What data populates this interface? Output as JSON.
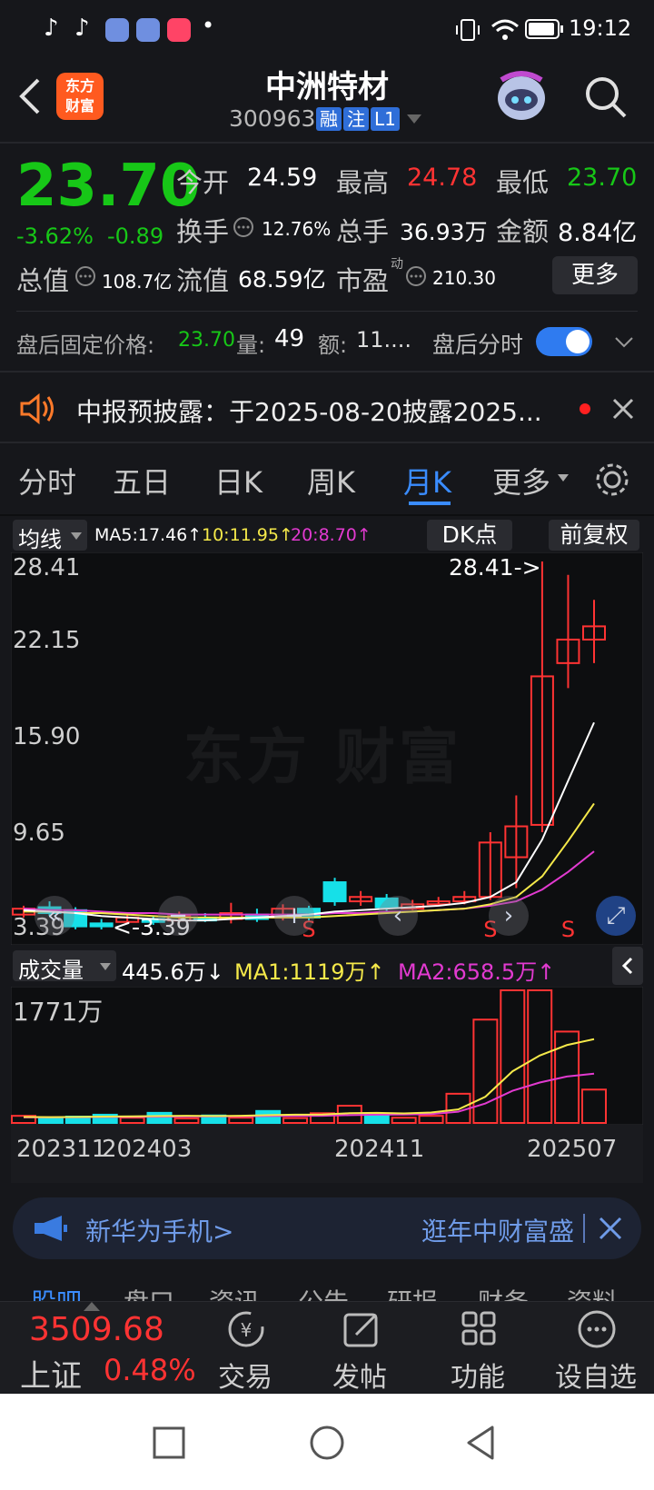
{
  "status_bar": {
    "time": "19:12",
    "dot": "•"
  },
  "header": {
    "logo_text": "东方\n财富",
    "stock_name": "中洲特材",
    "stock_code": "300963",
    "tags": [
      "融",
      "注",
      "L1"
    ]
  },
  "quote": {
    "price": "23.70",
    "change_pct": "-3.62%",
    "change": "-0.89",
    "open_label": "今开",
    "open": "24.59",
    "high_label": "最高",
    "high": "24.78",
    "low_label": "最低",
    "low": "23.70",
    "turnover_label": "换手",
    "turnover": "12.76%",
    "volume_label": "总手",
    "volume": "36.93万",
    "amount_label": "金额",
    "amount": "8.84亿",
    "mktcap_label": "总值",
    "mktcap": "108.7亿",
    "float_label": "流值",
    "float_cap": "68.59亿",
    "pe_label": "市盈",
    "pe_sup": "动",
    "pe": "210.30",
    "more_label": "更多"
  },
  "after_hours": {
    "price_label": "盘后固定价格:",
    "price": "23.70",
    "vol_label": "量:",
    "vol": "49",
    "amt_label": "额:",
    "amt": "11....",
    "toggle_label": "盘后分时",
    "toggle_on": true
  },
  "notice": {
    "text": "中报预披露：于2025-08-20披露2025..."
  },
  "tabs": [
    "分时",
    "五日",
    "日K",
    "周K",
    "月K",
    "更多"
  ],
  "active_tab": "月K",
  "chart_toolbar": {
    "ma_dropdown": "均线",
    "ma5": "MA5:17.46↑",
    "ma10": "10:11.95↑",
    "ma20": "20:8.70↑",
    "dk_label": "DK点",
    "adjust_label": "前复权"
  },
  "volume_toolbar": {
    "label": "成交量",
    "value": "445.6万↓",
    "ma1": "MA1:1119万↑",
    "ma2": "MA2:658.5万↑",
    "ymax": "1771万"
  },
  "colors": {
    "up": "#ff3333",
    "down": "#16e0e8",
    "ma5": "#ffffff",
    "ma10": "#f5e94a",
    "ma20": "#e23ad0",
    "accent": "#3a8cff"
  },
  "chart_data": {
    "type": "candlestick",
    "yticks": [
      "28.41",
      "22.15",
      "15.90",
      "9.65",
      "3.39"
    ],
    "ylim": [
      3.39,
      28.41
    ],
    "max_label": "28.41->",
    "min_label": "<-3.39",
    "sell_marker": "S",
    "xticks": [
      "202311",
      "202403",
      "202411",
      "202507"
    ],
    "candles": [
      {
        "o": 4.4,
        "c": 4.8,
        "h": 5.0,
        "l": 4.2
      },
      {
        "o": 4.9,
        "c": 4.5,
        "h": 5.3,
        "l": 4.3
      },
      {
        "o": 4.7,
        "c": 3.6,
        "h": 4.9,
        "l": 3.4
      },
      {
        "o": 3.8,
        "c": 3.6,
        "h": 4.1,
        "l": 3.39
      },
      {
        "o": 3.9,
        "c": 4.2,
        "h": 4.4,
        "l": 3.8
      },
      {
        "o": 4.1,
        "c": 3.9,
        "h": 4.3,
        "l": 3.7
      },
      {
        "o": 4.0,
        "c": 4.3,
        "h": 4.6,
        "l": 3.9
      },
      {
        "o": 4.2,
        "c": 4.0,
        "h": 4.5,
        "l": 3.9
      },
      {
        "o": 4.1,
        "c": 4.5,
        "h": 5.2,
        "l": 3.8
      },
      {
        "o": 4.4,
        "c": 4.1,
        "h": 4.8,
        "l": 3.9
      },
      {
        "o": 4.2,
        "c": 4.8,
        "h": 5.1,
        "l": 4.0
      },
      {
        "o": 4.8,
        "c": 4.2,
        "h": 5.0,
        "l": 4.0
      },
      {
        "o": 6.6,
        "c": 5.3,
        "h": 6.9,
        "l": 5.0
      },
      {
        "o": 5.3,
        "c": 5.6,
        "h": 6.0,
        "l": 5.0
      },
      {
        "o": 5.5,
        "c": 4.9,
        "h": 5.8,
        "l": 4.6
      },
      {
        "o": 4.8,
        "c": 5.1,
        "h": 5.4,
        "l": 4.7
      },
      {
        "o": 5.1,
        "c": 5.3,
        "h": 5.6,
        "l": 5.0
      },
      {
        "o": 5.3,
        "c": 5.6,
        "h": 6.0,
        "l": 5.1
      },
      {
        "o": 5.6,
        "c": 9.3,
        "h": 10.0,
        "l": 5.4
      },
      {
        "o": 8.3,
        "c": 10.4,
        "h": 12.5,
        "l": 6.2
      },
      {
        "o": 10.5,
        "c": 20.6,
        "h": 28.41,
        "l": 10.0
      },
      {
        "o": 21.5,
        "c": 23.1,
        "h": 27.5,
        "l": 19.8
      },
      {
        "o": 23.1,
        "c": 24.0,
        "h": 25.8,
        "l": 21.5
      }
    ],
    "ma5": [
      4.7,
      4.6,
      4.5,
      4.3,
      4.2,
      4.1,
      4.0,
      4.0,
      4.1,
      4.2,
      4.3,
      4.4,
      4.6,
      4.7,
      4.8,
      4.9,
      5.0,
      5.2,
      5.6,
      6.6,
      9.5,
      13.5,
      17.46
    ],
    "ma10": [
      4.6,
      4.6,
      4.5,
      4.5,
      4.4,
      4.3,
      4.2,
      4.2,
      4.2,
      4.2,
      4.2,
      4.2,
      4.3,
      4.4,
      4.5,
      4.6,
      4.7,
      4.8,
      5.1,
      5.6,
      7.0,
      9.4,
      11.95
    ],
    "ma20": [
      4.8,
      4.7,
      4.7,
      4.6,
      4.5,
      4.5,
      4.4,
      4.4,
      4.4,
      4.4,
      4.4,
      4.4,
      4.5,
      4.5,
      4.6,
      4.6,
      4.7,
      4.8,
      5.0,
      5.3,
      6.1,
      7.3,
      8.7
    ],
    "volume": [
      {
        "v": 95,
        "up": true
      },
      {
        "v": 55,
        "up": false
      },
      {
        "v": 85,
        "up": false
      },
      {
        "v": 110,
        "up": false
      },
      {
        "v": 70,
        "up": true
      },
      {
        "v": 135,
        "up": false
      },
      {
        "v": 60,
        "up": true
      },
      {
        "v": 100,
        "up": false
      },
      {
        "v": 70,
        "up": true
      },
      {
        "v": 160,
        "up": false
      },
      {
        "v": 65,
        "up": true
      },
      {
        "v": 130,
        "up": true
      },
      {
        "v": 230,
        "up": true
      },
      {
        "v": 115,
        "up": false
      },
      {
        "v": 70,
        "up": true
      },
      {
        "v": 95,
        "up": true
      },
      {
        "v": 390,
        "up": true
      },
      {
        "v": 1380,
        "up": true
      },
      {
        "v": 1771,
        "up": true
      },
      {
        "v": 1771,
        "up": true
      },
      {
        "v": 1220,
        "up": true
      },
      {
        "v": 445.6,
        "up": true
      }
    ],
    "vol_ma1": [
      80,
      78,
      80,
      85,
      88,
      92,
      95,
      92,
      96,
      105,
      110,
      112,
      130,
      135,
      128,
      140,
      180,
      350,
      690,
      900,
      1040,
      1119
    ],
    "vol_ma2": [
      75,
      76,
      78,
      80,
      82,
      84,
      86,
      88,
      90,
      92,
      94,
      96,
      105,
      110,
      112,
      118,
      150,
      260,
      430,
      540,
      620,
      658.5
    ]
  },
  "banner": {
    "left_text": "新华为手机>",
    "right_text": "逛年中财富盛"
  },
  "bottom_tabs_partial": [
    "股吧",
    "盘口",
    "资讯",
    "公告",
    "研报",
    "财务",
    "资料"
  ],
  "index": {
    "name": "上证",
    "value": "3509.68",
    "pct": "0.48%"
  },
  "bottom_nav": [
    {
      "label": "交易",
      "icon": "yen-icon"
    },
    {
      "label": "发帖",
      "icon": "edit-icon"
    },
    {
      "label": "功能",
      "icon": "grid-icon"
    },
    {
      "label": "设自选",
      "icon": "more-icon"
    }
  ]
}
